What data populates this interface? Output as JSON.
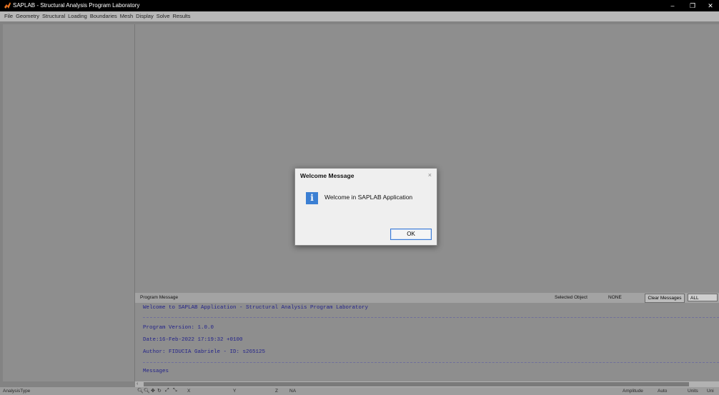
{
  "window": {
    "title": "SAPLAB - Structural Analysis Program Laboratory",
    "controls": {
      "minimize": "–",
      "maximize": "❐",
      "close": "✕"
    }
  },
  "menu": {
    "items": [
      "File",
      "Geometry",
      "Structural",
      "Loading",
      "Boundaries",
      "Mesh",
      "Display",
      "Solve",
      "Results"
    ]
  },
  "message_panel": {
    "header_label": "Program Message",
    "selected_object_label": "Selected Object",
    "selected_object_value": "NONE",
    "clear_button": "Clear Messages",
    "filter_value": "ALL",
    "lines": {
      "welcome": "Welcome to SAPLAB Application - Structural Analysis Program Laboratory",
      "version": "Program Version: 1.0.0",
      "date": "Date:16-Feb-2022 17:19:32 +0100",
      "author": "Author: FIDUCIA Gabriele - ID: s265125",
      "messages": "Messages"
    }
  },
  "statusbar": {
    "analysis_type_label": "AnalysisType",
    "x_label": "X",
    "y_label": "Y",
    "z_label": "Z",
    "coordinate_value": "NA",
    "amplitude_label": "Amplitude",
    "amplitude_value": "Auto",
    "units_label": "Units",
    "units_value": "Uni"
  },
  "dialog": {
    "title": "Welcome Message",
    "close": "×",
    "icon_glyph": "i",
    "message": "Welcome in SAPLAB Application",
    "ok_label": "OK"
  },
  "icons": {
    "app": "matlab-icon",
    "dialog": "info-icon"
  }
}
